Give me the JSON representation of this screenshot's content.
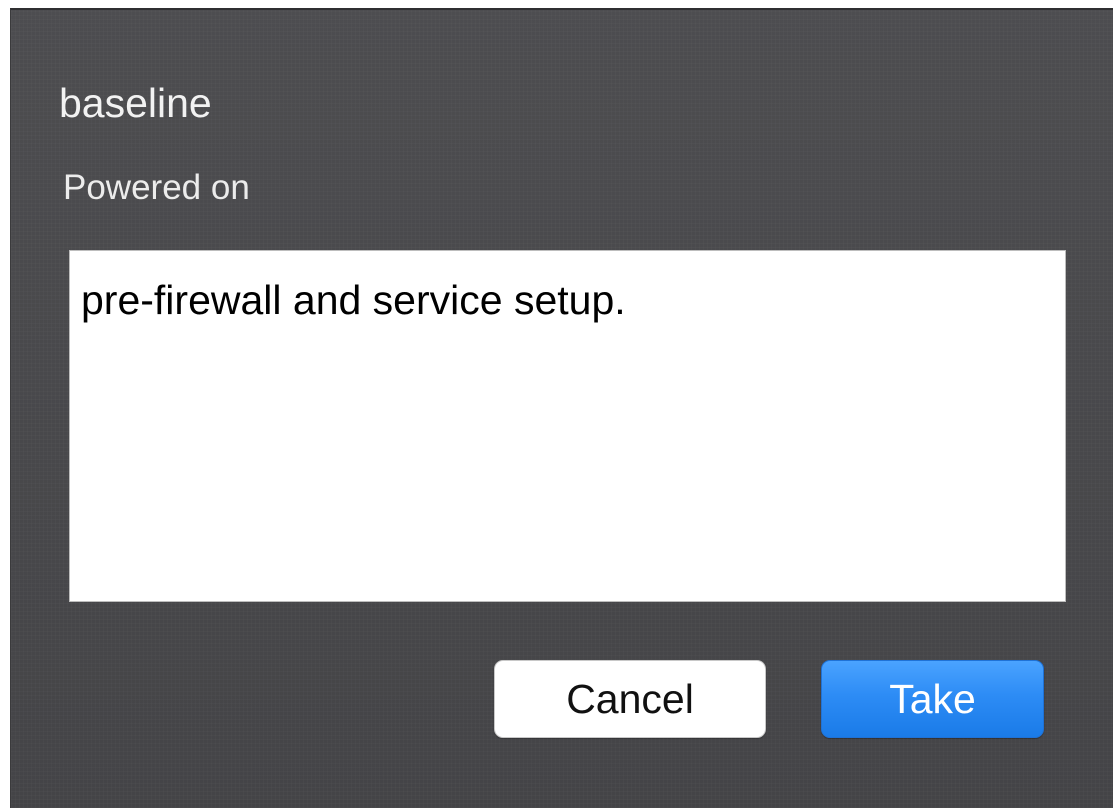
{
  "dialog": {
    "title": "baseline",
    "status": "Powered on",
    "description": "pre-firewall and service setup.",
    "buttons": {
      "cancel": "Cancel",
      "take": "Take"
    },
    "colors": {
      "background": "#47474a",
      "accent": "#2d8cf5"
    }
  }
}
